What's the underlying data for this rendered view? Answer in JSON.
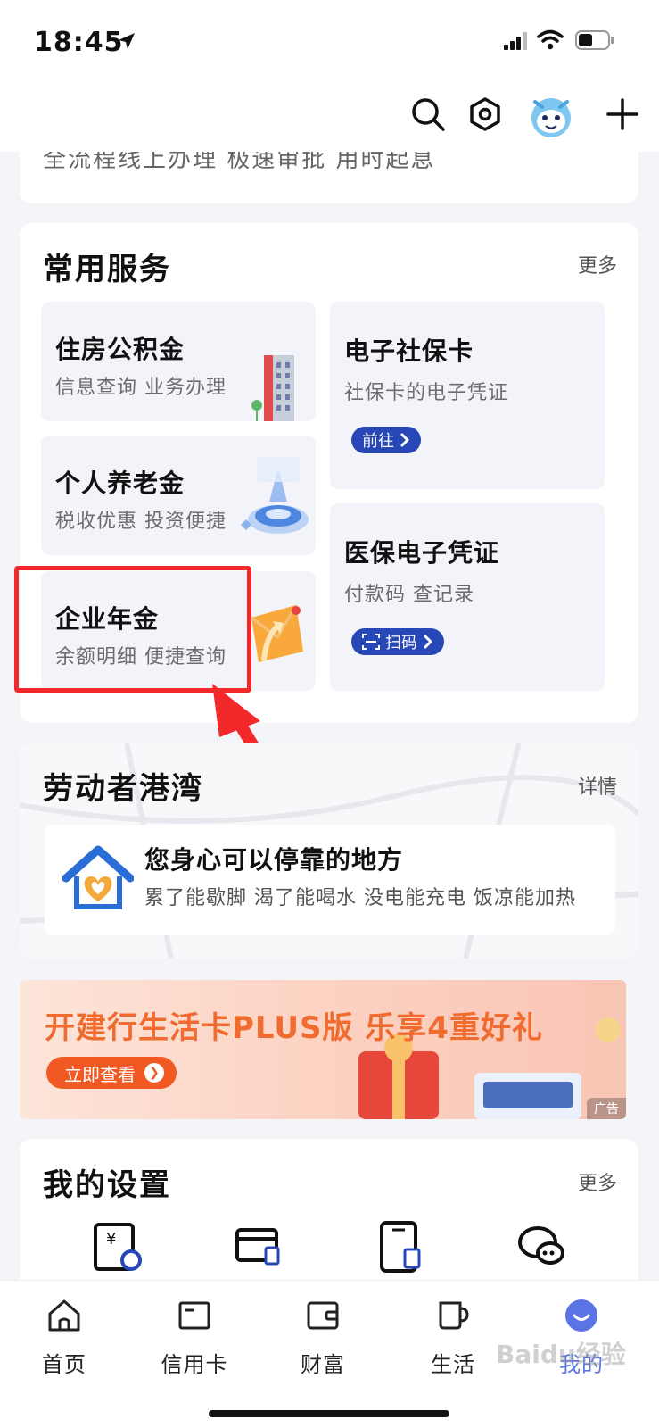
{
  "status_bar": {
    "time": "18:45"
  },
  "top_card": {
    "text": "全流程线上办理 极速审批 用时起息"
  },
  "services": {
    "title": "常用服务",
    "more": "更多",
    "tiles": [
      {
        "title": "住房公积金",
        "subtitle": "信息查询 业务办理"
      },
      {
        "title": "个人养老金",
        "subtitle": "税收优惠 投资便捷"
      },
      {
        "title": "企业年金",
        "subtitle": "余额明细 便捷查询"
      },
      {
        "title": "电子社保卡",
        "subtitle": "社保卡的电子凭证",
        "button": "前往"
      },
      {
        "title": "医保电子凭证",
        "subtitle": "付款码 查记录",
        "button": "扫码"
      }
    ]
  },
  "harbor": {
    "title": "劳动者港湾",
    "more": "详情",
    "headline": "您身心可以停靠的地方",
    "desc": "累了能歇脚 渴了能喝水 没电能充电 饭凉能加热"
  },
  "banner": {
    "text": "开建行生活卡PLUS版 乐享4重好礼",
    "button": "立即查看",
    "ad_label": "广告"
  },
  "settings": {
    "title": "我的设置",
    "more": "更多"
  },
  "bottom_nav": [
    {
      "label": "首页",
      "icon": "home-icon"
    },
    {
      "label": "信用卡",
      "icon": "card-icon"
    },
    {
      "label": "财富",
      "icon": "wallet-icon"
    },
    {
      "label": "生活",
      "icon": "cup-icon"
    },
    {
      "label": "我的",
      "icon": "profile-icon",
      "active": true
    }
  ],
  "watermark": "Baidu经验",
  "colors": {
    "accent": "#2747b7",
    "highlight": "#f2282a",
    "banner_orange": "#f05a22"
  }
}
